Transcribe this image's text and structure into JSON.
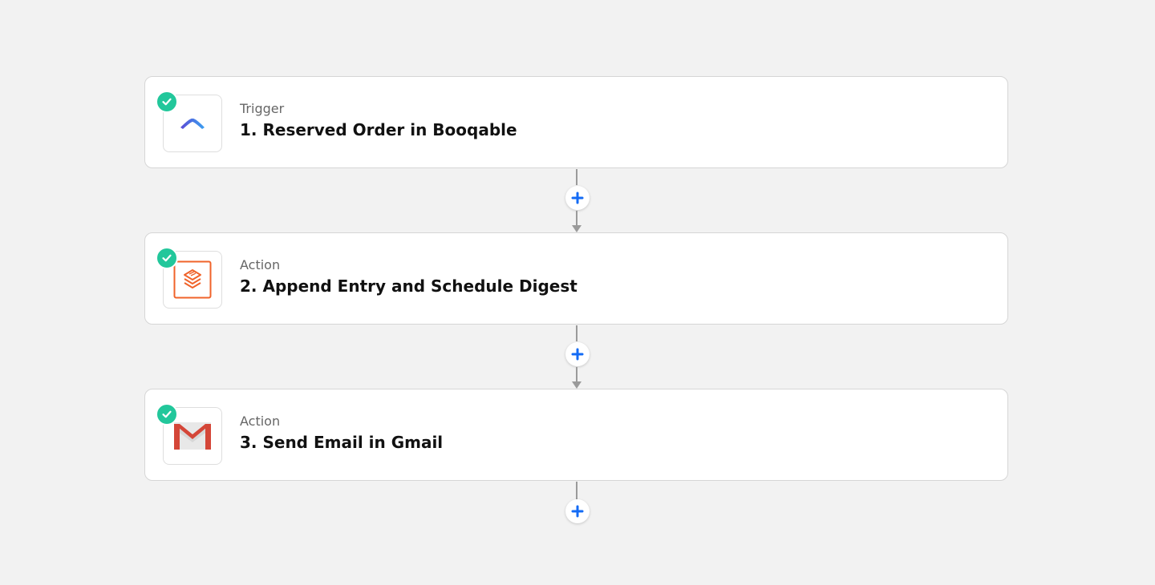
{
  "steps": [
    {
      "type": "Trigger",
      "title": "1. Reserved Order in Booqable",
      "app_icon": "booqable-icon"
    },
    {
      "type": "Action",
      "title": "2. Append Entry and Schedule Digest",
      "app_icon": "digest-icon"
    },
    {
      "type": "Action",
      "title": "3. Send Email in Gmail",
      "app_icon": "gmail-icon"
    }
  ],
  "colors": {
    "background": "#f2f2f2",
    "check_badge": "#22c79b",
    "add_button_plus": "#136bf5",
    "connector": "#9a9a9a",
    "digest_orange": "#f0632a",
    "gmail_red": "#d44638"
  },
  "status_icon": "check-circle-icon",
  "add_icon": "plus-icon"
}
